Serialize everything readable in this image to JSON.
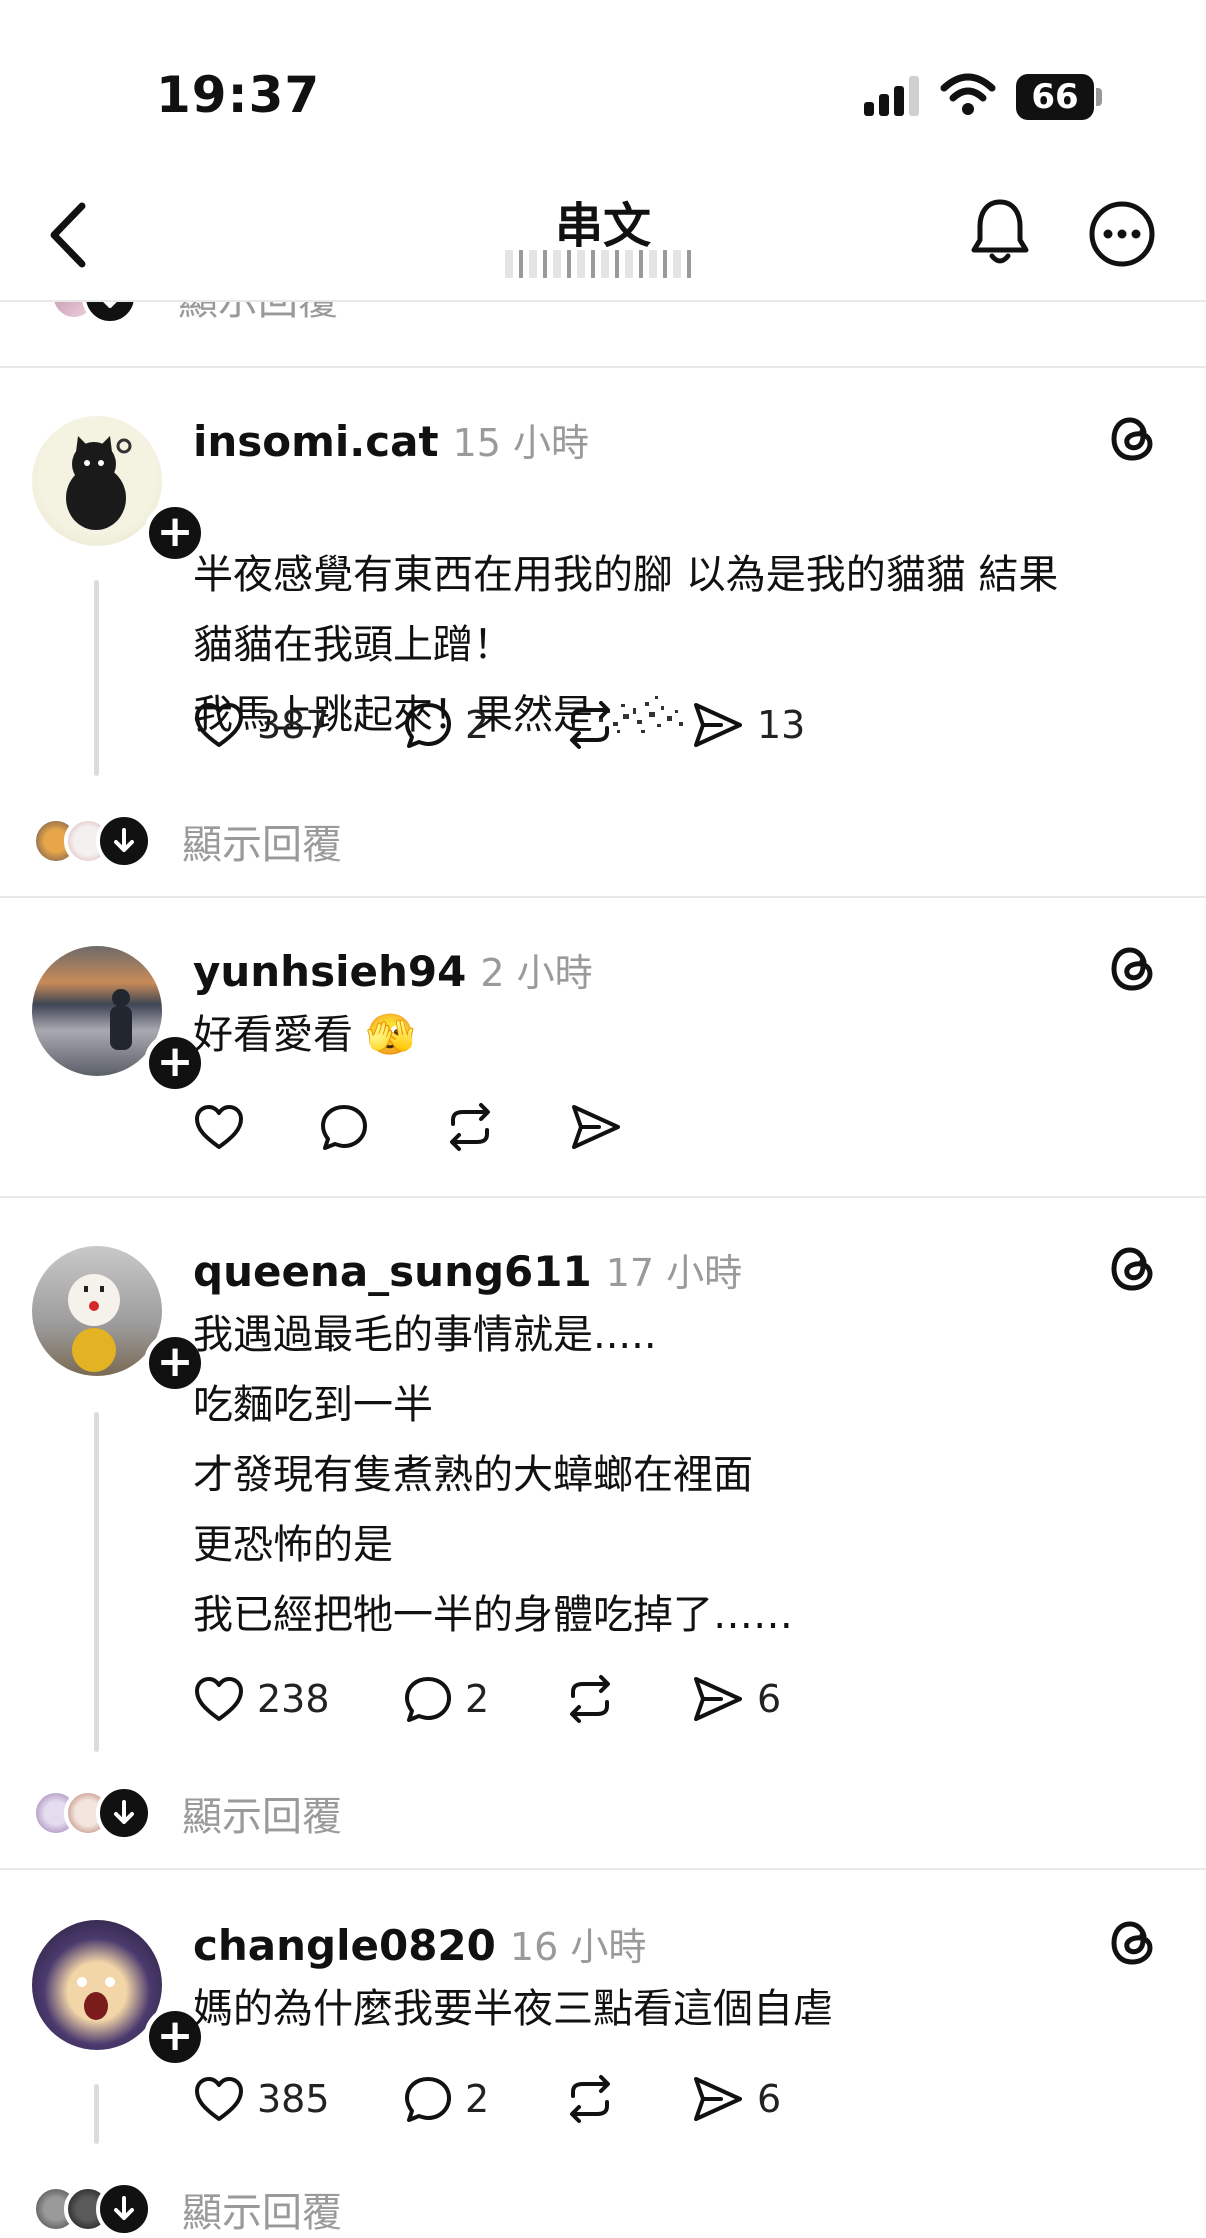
{
  "status_bar": {
    "time": "19:37",
    "battery": "66"
  },
  "nav": {
    "title": "串文"
  },
  "top_partial": {
    "show_replies": "顯示回覆"
  },
  "posts": [
    {
      "username": "insomi.cat",
      "time": "15 小時",
      "text": "半夜感覺有東西在用我的腳 以為是我的貓貓 結果\n貓貓在我頭上蹭！\n我馬上跳起來！果然是",
      "likes": "387",
      "comments": "2",
      "shares": "13",
      "show_replies": "顯示回覆"
    },
    {
      "username": "yunhsieh94",
      "time": "2 小時",
      "text": "好看愛看 🫣"
    },
    {
      "username": "queena_sung611",
      "time": "17 小時",
      "text": "我遇過最毛的事情就是.....\n吃麵吃到一半\n才發現有隻煮熟的大蟑螂在裡面\n更恐怖的是\n我已經把牠一半的身體吃掉了……",
      "likes": "238",
      "comments": "2",
      "shares": "6",
      "show_replies": "顯示回覆"
    },
    {
      "username": "changle0820",
      "time": "16 小時",
      "text": "媽的為什麼我要半夜三點看這個自虐",
      "likes": "385",
      "comments": "2",
      "shares": "6",
      "show_replies": "顯示回覆"
    }
  ]
}
